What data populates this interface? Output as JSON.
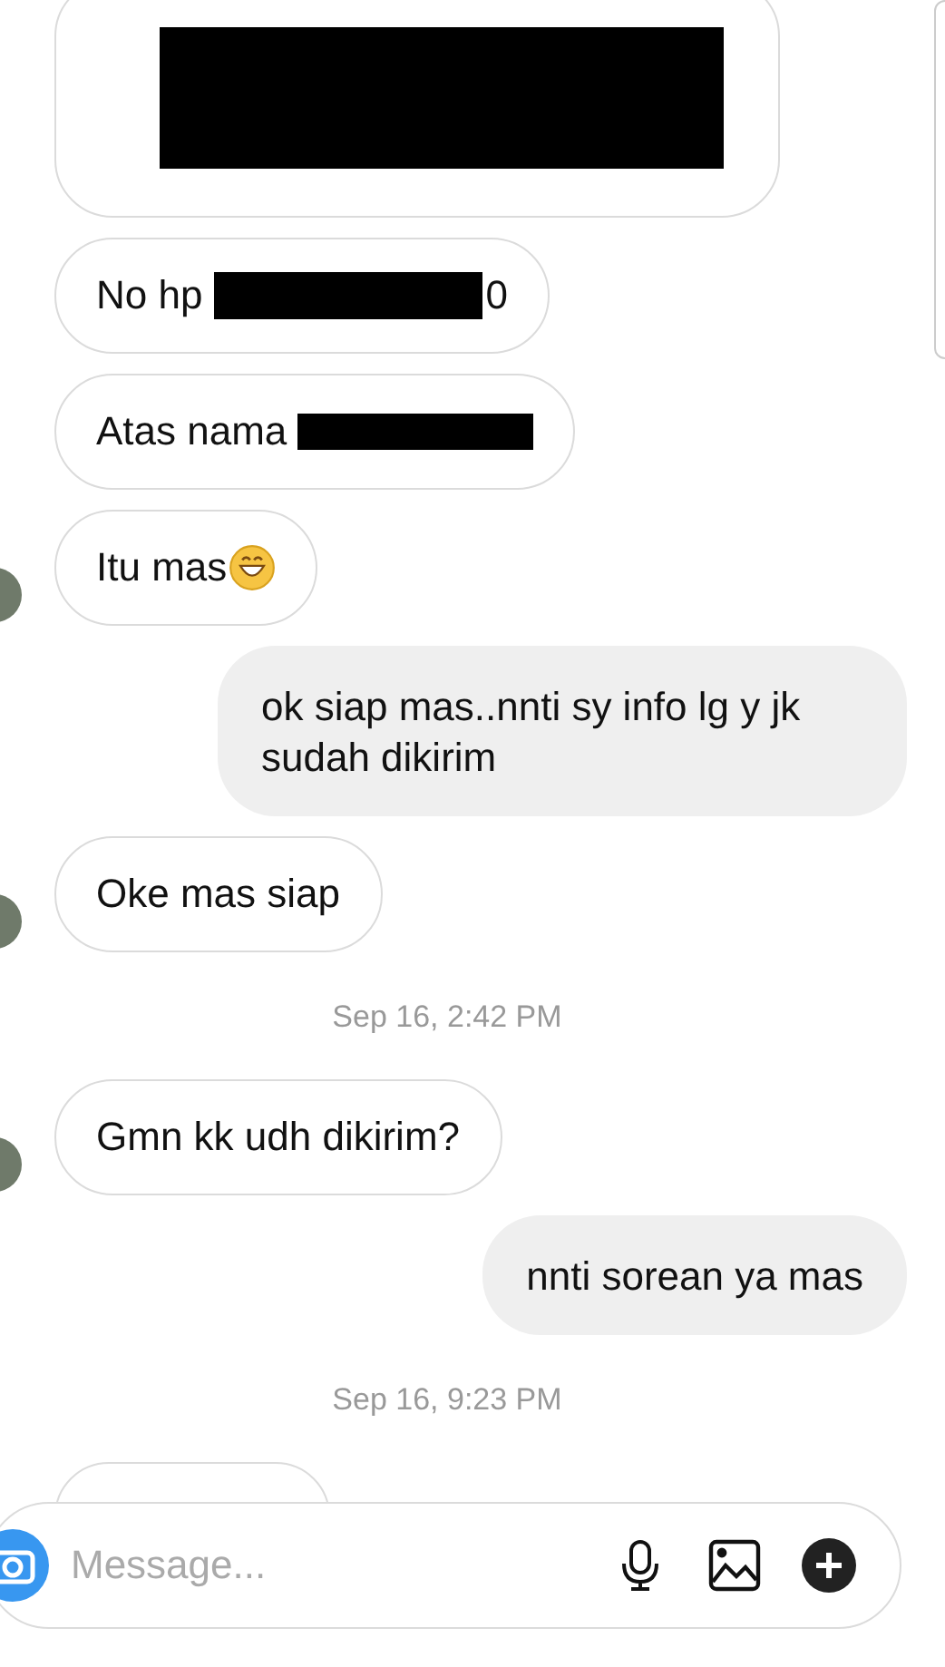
{
  "messages": [
    {
      "kind": "received",
      "avatar": false,
      "parts": [
        {
          "kind": "redaction-block"
        }
      ]
    },
    {
      "kind": "received",
      "avatar": false,
      "parts": [
        {
          "kind": "text",
          "text": "No hp"
        },
        {
          "kind": "redaction"
        },
        {
          "kind": "text",
          "text": "0"
        }
      ]
    },
    {
      "kind": "received",
      "avatar": false,
      "parts": [
        {
          "kind": "text",
          "text": "Atas nama"
        },
        {
          "kind": "redaction"
        }
      ]
    },
    {
      "kind": "received",
      "avatar": true,
      "parts": [
        {
          "kind": "text",
          "text": "Itu mas"
        },
        {
          "kind": "emoji"
        }
      ]
    },
    {
      "kind": "sent",
      "parts": [
        {
          "kind": "text",
          "text": "ok siap mas..nnti sy info lg y jk sudah dikirim"
        }
      ]
    },
    {
      "kind": "received",
      "avatar": true,
      "parts": [
        {
          "kind": "text",
          "text": "Oke mas siap"
        }
      ]
    },
    {
      "kind": "timestamp",
      "text": "Sep 16, 2:42 PM"
    },
    {
      "kind": "received",
      "avatar": true,
      "parts": [
        {
          "kind": "text",
          "text": "Gmn kk udh dikirim?"
        }
      ]
    },
    {
      "kind": "sent",
      "parts": [
        {
          "kind": "text",
          "text": "nnti sorean ya mas"
        }
      ]
    },
    {
      "kind": "timestamp",
      "text": "Sep 16, 9:23 PM"
    },
    {
      "kind": "partial"
    }
  ],
  "composer": {
    "placeholder": "Message..."
  }
}
